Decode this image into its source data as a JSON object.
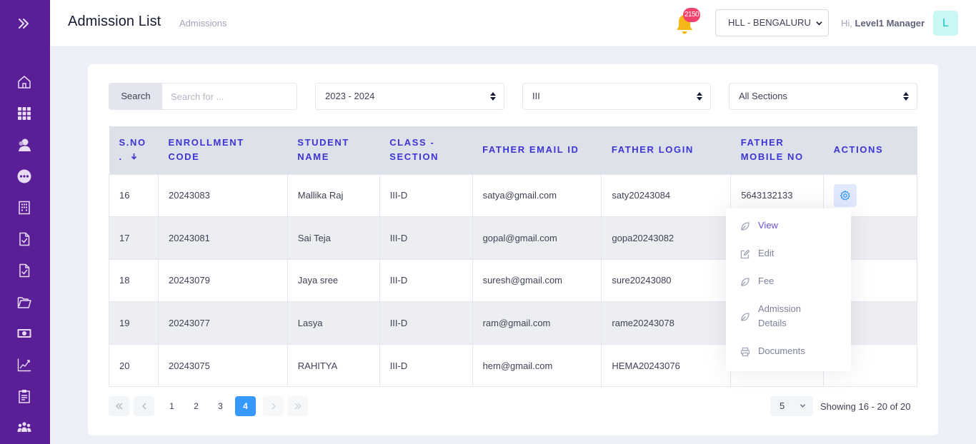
{
  "header": {
    "title": "Admission List",
    "subtitle": "Admissions",
    "notification_count": "2150",
    "branch": "HLL - BENGALURU",
    "greeting_prefix": "Hi,",
    "user_name": "Level1 Manager",
    "avatar_letter": "L"
  },
  "sidebar": {
    "items": [
      "home-icon",
      "apps-grid-icon",
      "user-icon",
      "more-icon",
      "building-icon",
      "document-check-icon",
      "document-check-icon",
      "folder-icon",
      "money-icon",
      "chart-line-icon",
      "clipboard-icon",
      "users-group-icon"
    ]
  },
  "filters": {
    "search_label": "Search",
    "search_placeholder": "Search for ...",
    "academic_year": "2023 - 2024",
    "class": "III",
    "section": "All Sections"
  },
  "table": {
    "columns": [
      "S.NO .",
      "ENROLLMENT CODE",
      "STUDENT NAME",
      "CLASS - SECTION",
      "FATHER EMAIL ID",
      "FATHER LOGIN",
      "FATHER MOBILE NO",
      "ACTIONS"
    ],
    "rows": [
      {
        "sno": "16",
        "code": "20243083",
        "name": "Mallika Raj",
        "class": "III-D",
        "email": "satya@gmail.com",
        "login": "saty20243084",
        "mobile": "5643132133"
      },
      {
        "sno": "17",
        "code": "20243081",
        "name": "Sai Teja",
        "class": "III-D",
        "email": "gopal@gmail.com",
        "login": "gopa20243082",
        "mobile": ""
      },
      {
        "sno": "18",
        "code": "20243079",
        "name": "Jaya sree",
        "class": "III-D",
        "email": "suresh@gmail.com",
        "login": "sure20243080",
        "mobile": ""
      },
      {
        "sno": "19",
        "code": "20243077",
        "name": "Lasya",
        "class": "III-D",
        "email": "ram@gmail.com",
        "login": "rame20243078",
        "mobile": ""
      },
      {
        "sno": "20",
        "code": "20243075",
        "name": "RAHITYA",
        "class": "III-D",
        "email": "hem@gmail.com",
        "login": "HEMA20243076",
        "mobile": ""
      }
    ]
  },
  "actions_menu": {
    "view": "View",
    "edit": "Edit",
    "fee": "Fee",
    "admission_details_1": "Admission",
    "admission_details_2": "Details",
    "documents": "Documents"
  },
  "pagination": {
    "pages": [
      "1",
      "2",
      "3",
      "4"
    ],
    "current": "4",
    "page_size": "5",
    "showing": "Showing 16 - 20 of 20"
  },
  "colors": {
    "sidebar": "#5a1e96",
    "header_text": "#3c35d4",
    "active_page": "#3699ff",
    "badge": "#f1416c"
  }
}
